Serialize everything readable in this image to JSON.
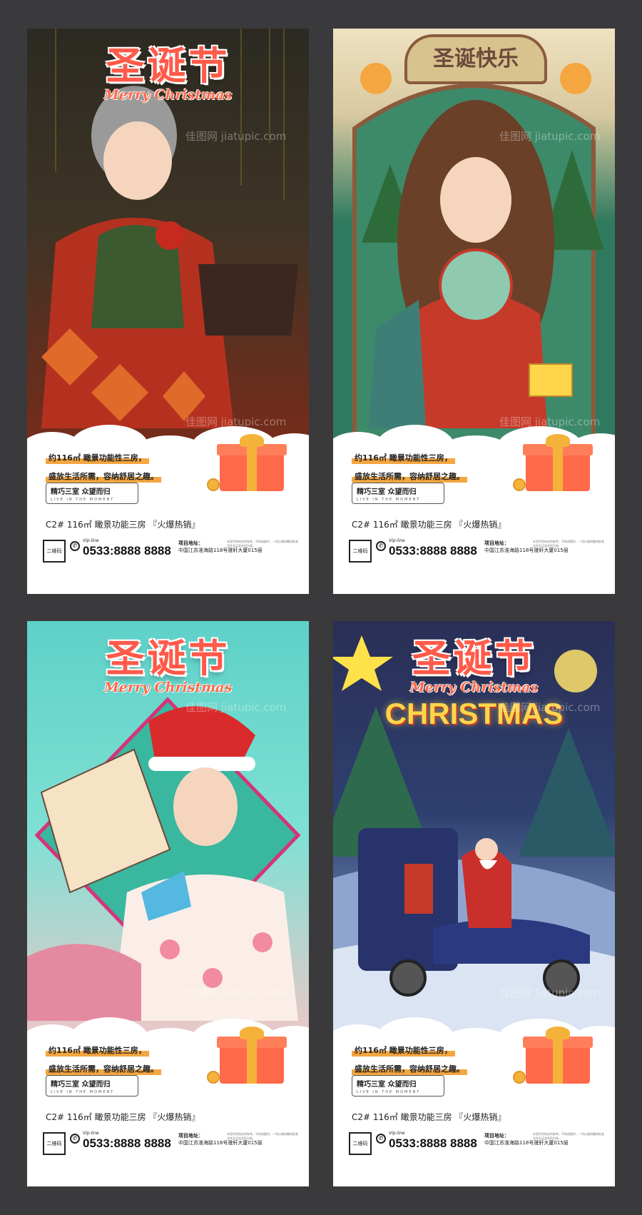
{
  "posters": [
    {
      "title_cn": "圣诞节",
      "title_en": "Merry Christmas",
      "line1": "约116㎡ 瞰景功能性三房，",
      "line2": "盛放生活所需，容纳舒居之趣。",
      "tag": "精巧三室 众望而归",
      "tag_sub": "LIVE IN THE MOMENT",
      "product": "C2#  116㎡ 瞰景功能三房 『火爆热销』",
      "qr": "二维码",
      "vip": "Vip-line",
      "phone": "0533:8888 8888",
      "addr_label": "项目地址：",
      "addr": "中国江苏淮海路118号晟轩大厦015层",
      "fine": "本宣传资料仅供参考，不构成要约，一切以政府最终批准文件及买卖合同为准。"
    },
    {
      "title_cn": "圣诞快乐",
      "line1": "约116㎡ 瞰景功能性三房，",
      "line2": "盛放生活所需，容纳舒居之趣。",
      "tag": "精巧三室 众望而归",
      "tag_sub": "LIVE IN THE MOMENT",
      "product": "C2#  116㎡ 瞰景功能三房 『火爆热销』",
      "qr": "二维码",
      "vip": "Vip-line",
      "phone": "0533:8888 8888",
      "addr_label": "项目地址：",
      "addr": "中国江苏淮海路118号晟轩大厦015层",
      "fine": "本宣传资料仅供参考，不构成要约，一切以政府最终批准文件及买卖合同为准。"
    },
    {
      "title_cn": "圣诞节",
      "title_en": "Merry Christmas",
      "line1": "约116㎡ 瞰景功能性三房，",
      "line2": "盛放生活所需，容纳舒居之趣。",
      "tag": "精巧三室 众望而归",
      "tag_sub": "LIVE IN THE MOMENT",
      "product": "C2#  116㎡ 瞰景功能三房 『火爆热销』",
      "qr": "二维码",
      "vip": "Vip-line",
      "phone": "0533:8888 8888",
      "addr_label": "项目地址：",
      "addr": "中国江苏淮海路118号晟轩大厦015层",
      "fine": "本宣传资料仅供参考，不构成要约，一切以政府最终批准文件及买卖合同为准。"
    },
    {
      "title_cn": "圣诞节",
      "title_en": "Merry Christmas",
      "title_en2": "CHRISTMAS",
      "line1": "约116㎡ 瞰景功能性三房，",
      "line2": "盛放生活所需，容纳舒居之趣。",
      "tag": "精巧三室 众望而归",
      "tag_sub": "LIVE IN THE MOMENT",
      "product": "C2#  116㎡ 瞰景功能三房 『火爆热销』",
      "qr": "二维码",
      "vip": "Vip-line",
      "phone": "0533:8888 8888",
      "addr_label": "项目地址：",
      "addr": "中国江苏淮海路118号晟轩大厦015层",
      "fine": "本宣传资料仅供参考，不构成要约，一切以政府最终批准文件及买卖合同为准。"
    }
  ],
  "watermark": "佳图网 jiatupic.com",
  "colors": {
    "background": "#3a3a3c",
    "title_red": "#ff5a4a",
    "highlight_orange": "#f4a640",
    "gift_red": "#ff6a4a",
    "ribbon_gold": "#f4b23a"
  }
}
